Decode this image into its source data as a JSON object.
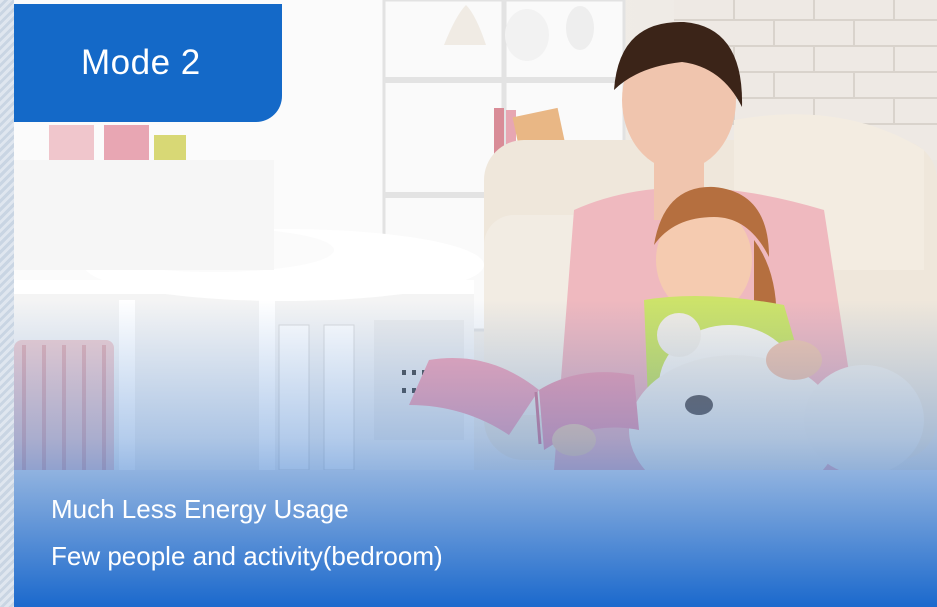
{
  "badge": {
    "label": "Mode 2"
  },
  "caption": {
    "line1": "Much Less Energy Usage",
    "line2": "Few people and activity(bedroom)"
  },
  "colors": {
    "badge_blue": "#1469c8",
    "overlay_blue": "#1e72d0"
  }
}
